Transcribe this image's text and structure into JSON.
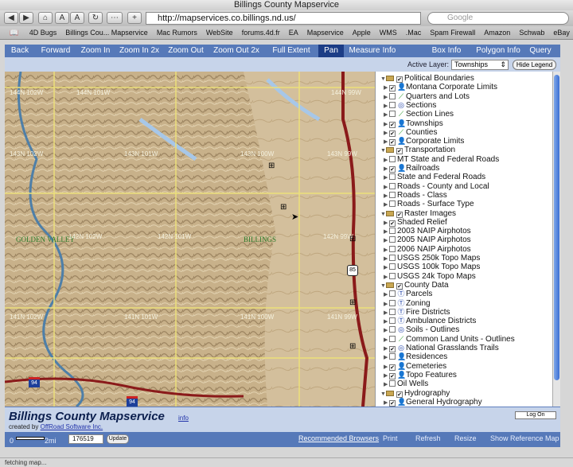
{
  "window": {
    "title": "Billings County Mapservice"
  },
  "browser": {
    "url": "http://mapservices.co.billings.nd.us/",
    "search_placeholder": "Google",
    "bookmarks": [
      "4D Bugs",
      "Billings Cou... Mapservice",
      "Mac Rumors",
      "WebSite",
      "forums.4d.fr",
      "EA",
      "Mapservice",
      "Apple",
      "WMS",
      ".Mac",
      "Spam Firewall",
      "Amazon",
      "Schwab",
      "eBay",
      "4D"
    ]
  },
  "nav": {
    "items": [
      {
        "label": "Back"
      },
      {
        "label": "Forward"
      },
      {
        "label": "Zoom In"
      },
      {
        "label": "Zoom In 2x"
      },
      {
        "label": "Zoom Out"
      },
      {
        "label": "Zoom Out 2x"
      },
      {
        "label": "Full Extent"
      },
      {
        "label": "Pan"
      },
      {
        "label": "Measure"
      },
      {
        "label": "Info"
      },
      {
        "label": "Box Info"
      },
      {
        "label": "Polygon Info"
      },
      {
        "label": "Query"
      }
    ],
    "active": "Pan"
  },
  "layerbar": {
    "active_layer_label": "Active Layer:",
    "active_layer_value": "Townships",
    "hide_legend": "Hide Legend"
  },
  "map": {
    "town_labels": [
      "GOLDEN VALLEY",
      "BILLINGS"
    ],
    "grid_labels": [
      "144N 102W",
      "144N 101W",
      "144N 99W",
      "143N 102W",
      "143N 101W",
      "143N 100W",
      "143N 99W",
      "142N 102W",
      "142N 101W",
      "142N 99W",
      "141N 102W",
      "141N 101W",
      "141N 100W",
      "141N 99W"
    ],
    "shields": [
      "85",
      "94",
      "94"
    ]
  },
  "legend": {
    "rows": [
      {
        "label": "Political Boundaries",
        "kind": "group",
        "checked": true
      },
      {
        "label": "Montana Corporate Limits",
        "kind": "layer",
        "checked": true,
        "icon": "person-icon"
      },
      {
        "label": "Quarters and Lots",
        "kind": "layer",
        "checked": false,
        "icon": "line-icon"
      },
      {
        "label": "Sections",
        "kind": "layer",
        "checked": false,
        "icon": "polygon-icon"
      },
      {
        "label": "Section Lines",
        "kind": "layer",
        "checked": false,
        "icon": "line-icon"
      },
      {
        "label": "Townships",
        "kind": "layer",
        "checked": true,
        "icon": "person-icon"
      },
      {
        "label": "Counties",
        "kind": "layer",
        "checked": true,
        "icon": "line-icon"
      },
      {
        "label": "Corporate Limits",
        "kind": "layer",
        "checked": true,
        "icon": "person-icon"
      },
      {
        "label": "Transportation",
        "kind": "group",
        "checked": true
      },
      {
        "label": "MT State and Federal Roads",
        "kind": "layer",
        "checked": false,
        "icon": ""
      },
      {
        "label": "Railroads",
        "kind": "layer",
        "checked": true,
        "icon": "person-icon"
      },
      {
        "label": "State and Federal Roads",
        "kind": "layer",
        "checked": false,
        "icon": ""
      },
      {
        "label": "Roads - County and Local",
        "kind": "layer",
        "checked": false,
        "icon": ""
      },
      {
        "label": "Roads - Class",
        "kind": "layer",
        "checked": false,
        "icon": ""
      },
      {
        "label": "Roads - Surface Type",
        "kind": "layer",
        "checked": false,
        "icon": ""
      },
      {
        "label": "Raster Images",
        "kind": "group",
        "checked": true
      },
      {
        "label": "Shaded Relief",
        "kind": "layer",
        "checked": true,
        "icon": ""
      },
      {
        "label": "2003 NAIP Airphotos",
        "kind": "layer",
        "checked": false,
        "icon": ""
      },
      {
        "label": "2005 NAIP Airphotos",
        "kind": "layer",
        "checked": false,
        "icon": ""
      },
      {
        "label": "2006 NAIP Airphotos",
        "kind": "layer",
        "checked": false,
        "icon": ""
      },
      {
        "label": "USGS 250k Topo Maps",
        "kind": "layer",
        "checked": false,
        "icon": ""
      },
      {
        "label": "USGS 100k Topo Maps",
        "kind": "layer",
        "checked": false,
        "icon": ""
      },
      {
        "label": "USGS 24k Topo Maps",
        "kind": "layer",
        "checked": false,
        "icon": ""
      },
      {
        "label": "County Data",
        "kind": "group",
        "checked": true
      },
      {
        "label": "Parcels",
        "kind": "layer",
        "checked": false,
        "icon": "t-icon"
      },
      {
        "label": "Zoning",
        "kind": "layer",
        "checked": false,
        "icon": "t-icon"
      },
      {
        "label": "Fire Districts",
        "kind": "layer",
        "checked": false,
        "icon": "t-icon"
      },
      {
        "label": "Ambulance Districts",
        "kind": "layer",
        "checked": false,
        "icon": "t-icon"
      },
      {
        "label": "Soils - Outlines",
        "kind": "layer",
        "checked": false,
        "icon": "polygon-icon"
      },
      {
        "label": "Common Land Units - Outlines",
        "kind": "layer",
        "checked": false,
        "icon": "line-icon"
      },
      {
        "label": "National Grasslands Trails",
        "kind": "layer",
        "checked": true,
        "icon": "polygon-icon"
      },
      {
        "label": "Residences",
        "kind": "layer",
        "checked": false,
        "icon": "person-icon"
      },
      {
        "label": "Cemeteries",
        "kind": "layer",
        "checked": true,
        "icon": "person-icon"
      },
      {
        "label": "Topo Features",
        "kind": "layer",
        "checked": true,
        "icon": "person-icon"
      },
      {
        "label": "Oil Wells",
        "kind": "layer",
        "checked": false,
        "icon": ""
      },
      {
        "label": "Hydrography",
        "kind": "group",
        "checked": true
      },
      {
        "label": "General Hydrography",
        "kind": "layer",
        "checked": true,
        "icon": "person-icon"
      }
    ]
  },
  "footer": {
    "title": "Billings County Mapservice",
    "info": "info",
    "created_by": "created by",
    "company": "OffRoad Software Inc.",
    "logon": "Log On"
  },
  "bottombar": {
    "scale_zero": "0",
    "scale_units": "2mi",
    "scale_value": "176519",
    "update": "Update",
    "recommended": "Recommended Browsers",
    "print": "Print",
    "refresh": "Refresh",
    "resize": "Resize",
    "show_ref": "Show Reference Map"
  },
  "status": "fetching map..."
}
